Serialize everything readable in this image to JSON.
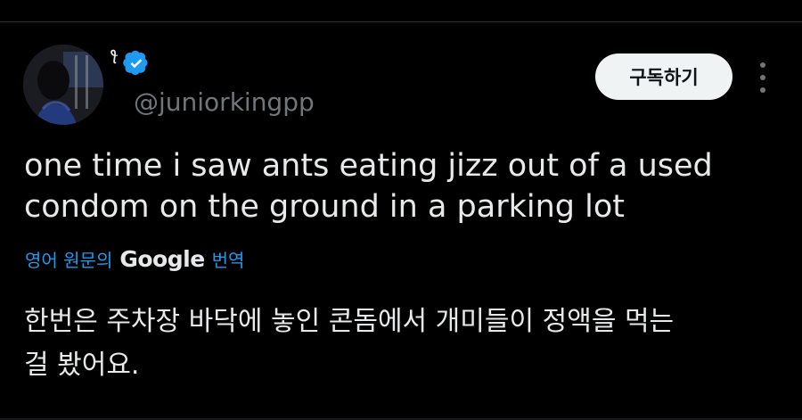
{
  "post": {
    "author": {
      "display_name": "ꪻ",
      "handle": "@juniorkingpp",
      "verified": true,
      "avatar_icon": "profile-photo"
    },
    "subscribe_label": "구독하기",
    "more_icon": "more-vertical-icon",
    "text_line1": "one time i saw ants eating jizz out of a used",
    "text_line2": "condom on the ground in a parking lot",
    "translation": {
      "prefix": "영어 원문의",
      "provider": "Google",
      "suffix": "번역",
      "text_line1": "한번은 주차장 바닥에 놓인 콘돔에서 개미들이 정액을 먹는",
      "text_line2": "걸 봤어요."
    }
  },
  "colors": {
    "background": "#000000",
    "text": "#e7e9ea",
    "secondary": "#71767b",
    "accent": "#1d9bf0",
    "button_bg": "#eff3f4"
  }
}
